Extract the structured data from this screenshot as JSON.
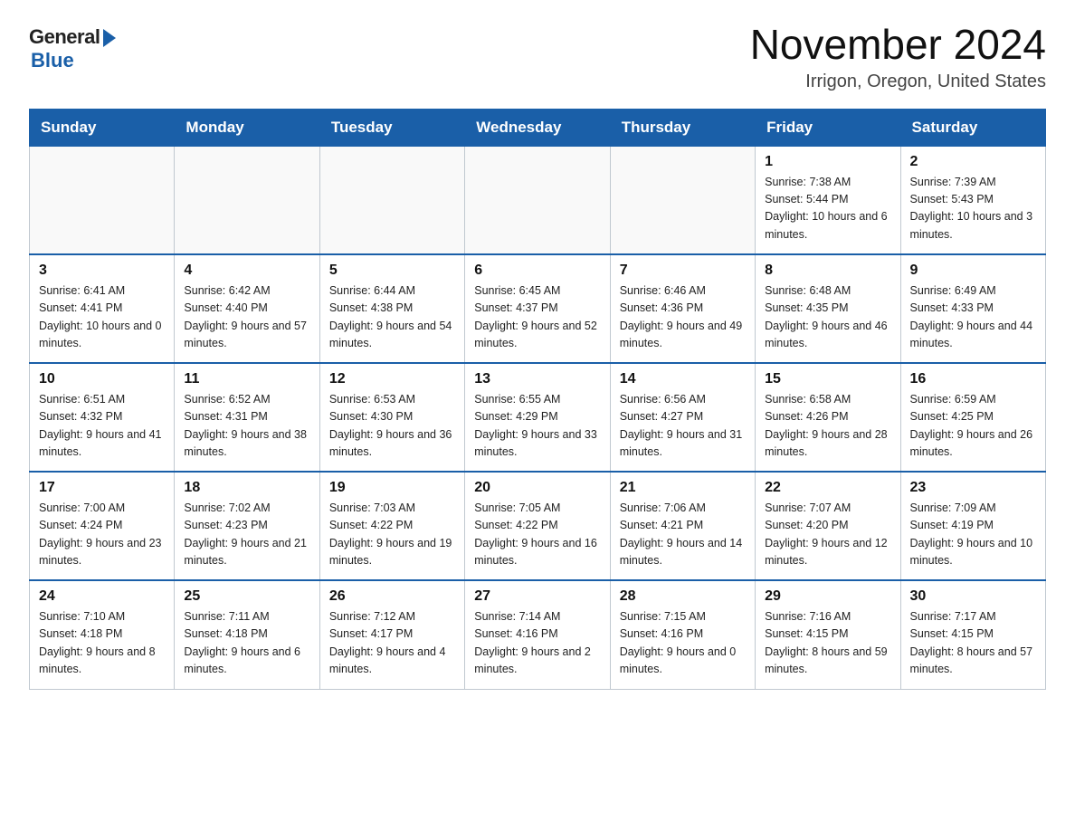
{
  "header": {
    "logo_general": "General",
    "logo_blue": "Blue",
    "month_year": "November 2024",
    "location": "Irrigon, Oregon, United States"
  },
  "days_of_week": [
    "Sunday",
    "Monday",
    "Tuesday",
    "Wednesday",
    "Thursday",
    "Friday",
    "Saturday"
  ],
  "weeks": [
    [
      {
        "num": "",
        "info": ""
      },
      {
        "num": "",
        "info": ""
      },
      {
        "num": "",
        "info": ""
      },
      {
        "num": "",
        "info": ""
      },
      {
        "num": "",
        "info": ""
      },
      {
        "num": "1",
        "info": "Sunrise: 7:38 AM\nSunset: 5:44 PM\nDaylight: 10 hours and 6 minutes."
      },
      {
        "num": "2",
        "info": "Sunrise: 7:39 AM\nSunset: 5:43 PM\nDaylight: 10 hours and 3 minutes."
      }
    ],
    [
      {
        "num": "3",
        "info": "Sunrise: 6:41 AM\nSunset: 4:41 PM\nDaylight: 10 hours and 0 minutes."
      },
      {
        "num": "4",
        "info": "Sunrise: 6:42 AM\nSunset: 4:40 PM\nDaylight: 9 hours and 57 minutes."
      },
      {
        "num": "5",
        "info": "Sunrise: 6:44 AM\nSunset: 4:38 PM\nDaylight: 9 hours and 54 minutes."
      },
      {
        "num": "6",
        "info": "Sunrise: 6:45 AM\nSunset: 4:37 PM\nDaylight: 9 hours and 52 minutes."
      },
      {
        "num": "7",
        "info": "Sunrise: 6:46 AM\nSunset: 4:36 PM\nDaylight: 9 hours and 49 minutes."
      },
      {
        "num": "8",
        "info": "Sunrise: 6:48 AM\nSunset: 4:35 PM\nDaylight: 9 hours and 46 minutes."
      },
      {
        "num": "9",
        "info": "Sunrise: 6:49 AM\nSunset: 4:33 PM\nDaylight: 9 hours and 44 minutes."
      }
    ],
    [
      {
        "num": "10",
        "info": "Sunrise: 6:51 AM\nSunset: 4:32 PM\nDaylight: 9 hours and 41 minutes."
      },
      {
        "num": "11",
        "info": "Sunrise: 6:52 AM\nSunset: 4:31 PM\nDaylight: 9 hours and 38 minutes."
      },
      {
        "num": "12",
        "info": "Sunrise: 6:53 AM\nSunset: 4:30 PM\nDaylight: 9 hours and 36 minutes."
      },
      {
        "num": "13",
        "info": "Sunrise: 6:55 AM\nSunset: 4:29 PM\nDaylight: 9 hours and 33 minutes."
      },
      {
        "num": "14",
        "info": "Sunrise: 6:56 AM\nSunset: 4:27 PM\nDaylight: 9 hours and 31 minutes."
      },
      {
        "num": "15",
        "info": "Sunrise: 6:58 AM\nSunset: 4:26 PM\nDaylight: 9 hours and 28 minutes."
      },
      {
        "num": "16",
        "info": "Sunrise: 6:59 AM\nSunset: 4:25 PM\nDaylight: 9 hours and 26 minutes."
      }
    ],
    [
      {
        "num": "17",
        "info": "Sunrise: 7:00 AM\nSunset: 4:24 PM\nDaylight: 9 hours and 23 minutes."
      },
      {
        "num": "18",
        "info": "Sunrise: 7:02 AM\nSunset: 4:23 PM\nDaylight: 9 hours and 21 minutes."
      },
      {
        "num": "19",
        "info": "Sunrise: 7:03 AM\nSunset: 4:22 PM\nDaylight: 9 hours and 19 minutes."
      },
      {
        "num": "20",
        "info": "Sunrise: 7:05 AM\nSunset: 4:22 PM\nDaylight: 9 hours and 16 minutes."
      },
      {
        "num": "21",
        "info": "Sunrise: 7:06 AM\nSunset: 4:21 PM\nDaylight: 9 hours and 14 minutes."
      },
      {
        "num": "22",
        "info": "Sunrise: 7:07 AM\nSunset: 4:20 PM\nDaylight: 9 hours and 12 minutes."
      },
      {
        "num": "23",
        "info": "Sunrise: 7:09 AM\nSunset: 4:19 PM\nDaylight: 9 hours and 10 minutes."
      }
    ],
    [
      {
        "num": "24",
        "info": "Sunrise: 7:10 AM\nSunset: 4:18 PM\nDaylight: 9 hours and 8 minutes."
      },
      {
        "num": "25",
        "info": "Sunrise: 7:11 AM\nSunset: 4:18 PM\nDaylight: 9 hours and 6 minutes."
      },
      {
        "num": "26",
        "info": "Sunrise: 7:12 AM\nSunset: 4:17 PM\nDaylight: 9 hours and 4 minutes."
      },
      {
        "num": "27",
        "info": "Sunrise: 7:14 AM\nSunset: 4:16 PM\nDaylight: 9 hours and 2 minutes."
      },
      {
        "num": "28",
        "info": "Sunrise: 7:15 AM\nSunset: 4:16 PM\nDaylight: 9 hours and 0 minutes."
      },
      {
        "num": "29",
        "info": "Sunrise: 7:16 AM\nSunset: 4:15 PM\nDaylight: 8 hours and 59 minutes."
      },
      {
        "num": "30",
        "info": "Sunrise: 7:17 AM\nSunset: 4:15 PM\nDaylight: 8 hours and 57 minutes."
      }
    ]
  ]
}
